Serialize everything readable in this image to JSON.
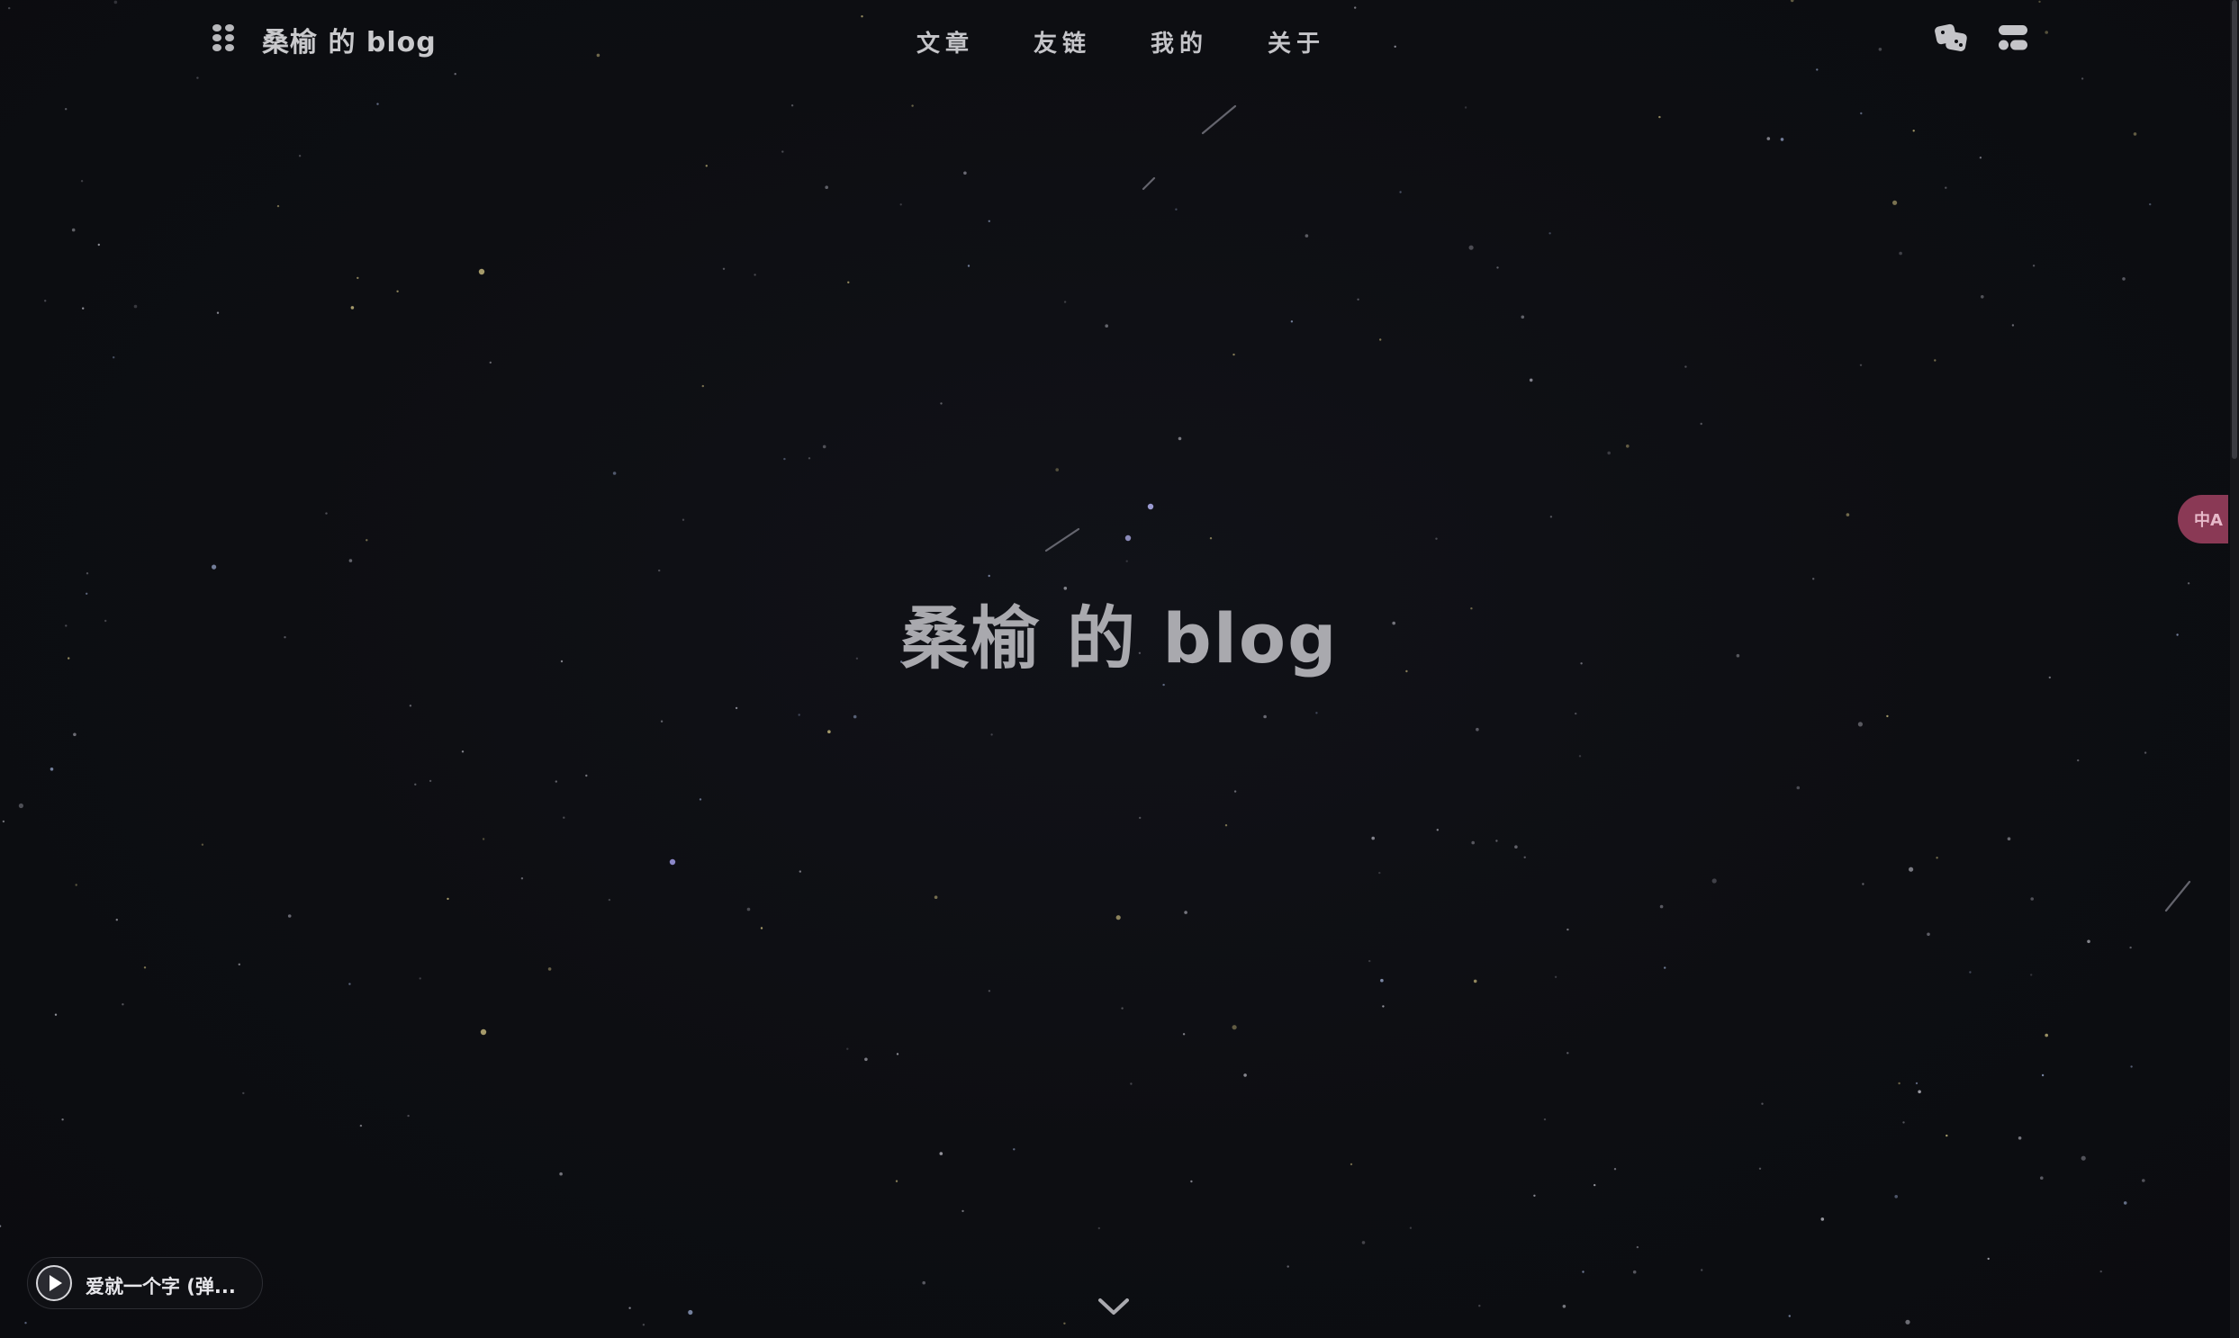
{
  "header": {
    "menu_icon": "grid-dots-icon",
    "site_title": "桑榆 的 blog",
    "nav": [
      {
        "label": "文章"
      },
      {
        "label": "友链"
      },
      {
        "label": "我的"
      },
      {
        "label": "关于"
      }
    ],
    "right_icons": [
      "dice-icon",
      "toggle-layout-icon"
    ]
  },
  "hero": {
    "title": "桑榆 的 blog",
    "scroll_icon": "chevron-down-icon"
  },
  "music_player": {
    "song": "爱就一个字 (弹...",
    "icon": "play-icon"
  },
  "translate_button": {
    "label": "中A",
    "icon": "translate-icon"
  },
  "colors": {
    "background": "#0d0e12",
    "text": "#c9c9cc",
    "hero_text": "#a9a9ae",
    "translate_bg": "#8a3955"
  }
}
